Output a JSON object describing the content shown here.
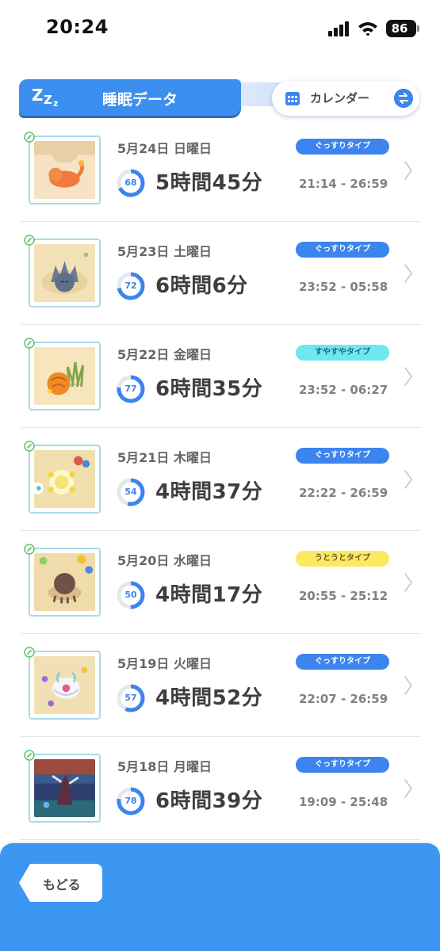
{
  "status_bar": {
    "time": "20:24",
    "battery": "86"
  },
  "header": {
    "tab_title": "睡眠データ",
    "calendar_label": "カレンダー"
  },
  "colors": {
    "accent": "#3c84ee",
    "badge_deep": "#3c84ee",
    "badge_good": "#6ee8f0",
    "badge_light": "#ffe861",
    "footer": "#3c97f2"
  },
  "records": [
    {
      "date": "5月24日 日曜日",
      "type": "ぐっすりタイプ",
      "type_key": "deep",
      "score": "68",
      "score_value": 68,
      "duration": "5時間45分",
      "time_range": "21:14 - 26:59",
      "thumbnail": "sleeping-orange-pokemon"
    },
    {
      "date": "5月23日 土曜日",
      "type": "ぐっすりタイプ",
      "type_key": "deep",
      "score": "72",
      "score_value": 72,
      "duration": "6時間6分",
      "time_range": "23:52 - 05:58",
      "thumbnail": "sleeping-spiky-pokemon"
    },
    {
      "date": "5月22日 金曜日",
      "type": "すやすやタイプ",
      "type_key": "good",
      "score": "77",
      "score_value": 77,
      "duration": "6時間35分",
      "time_range": "23:52 - 06:27",
      "thumbnail": "sleeping-leaf-pokemon"
    },
    {
      "date": "5月21日 木曜日",
      "type": "ぐっすりタイプ",
      "type_key": "deep",
      "score": "54",
      "score_value": 54,
      "duration": "4時間37分",
      "time_range": "22:22 - 26:59",
      "thumbnail": "sleeping-flower-pokemon"
    },
    {
      "date": "5月20日 水曜日",
      "type": "うとうとタイプ",
      "type_key": "light",
      "score": "50",
      "score_value": 50,
      "duration": "4時間17分",
      "time_range": "20:55 - 25:12",
      "thumbnail": "sleeping-brown-pokemon"
    },
    {
      "date": "5月19日 火曜日",
      "type": "ぐっすりタイプ",
      "type_key": "deep",
      "score": "57",
      "score_value": 57,
      "duration": "4時間52分",
      "time_range": "22:07 - 26:59",
      "thumbnail": "sleeping-white-pokemon"
    },
    {
      "date": "5月18日 月曜日",
      "type": "ぐっすりタイプ",
      "type_key": "deep",
      "score": "78",
      "score_value": 78,
      "duration": "6時間39分",
      "time_range": "19:09 - 25:48",
      "thumbnail": "sleeping-dark-pokemon"
    }
  ],
  "footer": {
    "back_label": "もどる"
  }
}
